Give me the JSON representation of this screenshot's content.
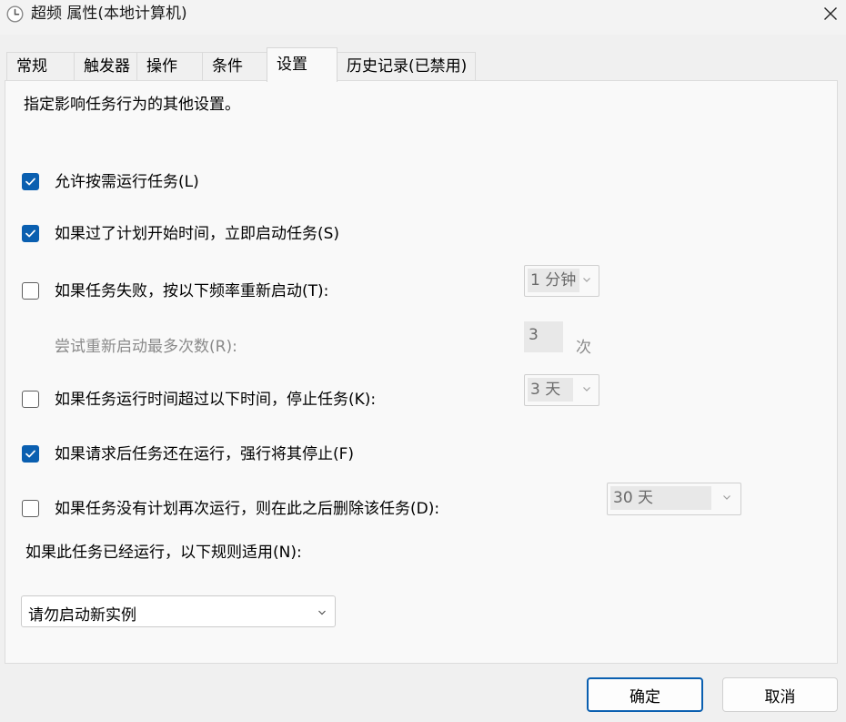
{
  "window": {
    "title": "超频 属性(本地计算机)"
  },
  "tabs": [
    "常规",
    "触发器",
    "操作",
    "条件",
    "设置",
    "历史记录(已禁用)"
  ],
  "settings": {
    "description": "指定影响任务行为的其他设置。",
    "allow_on_demand": {
      "label": "允许按需运行任务(L)",
      "checked": true
    },
    "run_asap_missed": {
      "label": "如果过了计划开始时间，立即启动任务(S)",
      "checked": true
    },
    "restart_on_fail": {
      "label": "如果任务失败，按以下频率重新启动(T):",
      "checked": false,
      "interval": "1 分钟"
    },
    "restart_attempts": {
      "label": "尝试重新启动最多次数(R):",
      "value": "3",
      "unit": "次"
    },
    "stop_if_runs_longer": {
      "label": "如果任务运行时间超过以下时间，停止任务(K):",
      "checked": false,
      "duration": "3 天"
    },
    "force_stop": {
      "label": "如果请求后任务还在运行，强行将其停止(F)",
      "checked": true
    },
    "delete_if_not_scheduled": {
      "label": "如果任务没有计划再次运行，则在此之后删除该任务(D):",
      "checked": false,
      "after": "30 天"
    },
    "running_rule": {
      "label": "如果此任务已经运行，以下规则适用(N):",
      "value": "请勿启动新实例"
    }
  },
  "buttons": {
    "ok": "确定",
    "cancel": "取消"
  },
  "colors": {
    "accent": "#0a5fb0",
    "panel": "#f9f9f9",
    "window": "#f0f0f0"
  }
}
